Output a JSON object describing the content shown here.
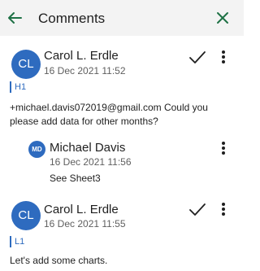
{
  "header": {
    "title": "Comments",
    "back_icon": "back-arrow-icon",
    "close_icon": "close-icon",
    "accent": "#1e7145"
  },
  "comments": [
    {
      "initials": "CL",
      "author": "Carol L. Erdle",
      "timestamp": "16 Dec 2021 11:52",
      "cell": "H1",
      "text": "+michael.davis072019@gmail.com Could you please add data for other months?",
      "resolved_icon": "checkmark-icon",
      "reply": {
        "initials": "MD",
        "author": "Michael Davis",
        "timestamp": "16 Dec 2021 11:56",
        "text": "See Sheet3"
      }
    },
    {
      "initials": "CL",
      "author": "Carol L. Erdle",
      "timestamp": "16 Dec 2021 11:55",
      "cell": "L1",
      "text": "Let's add some charts.",
      "resolved_icon": "checkmark-icon"
    }
  ],
  "colors": {
    "avatar": "#2e6bbf",
    "header_bg": "#f3f3f3"
  }
}
